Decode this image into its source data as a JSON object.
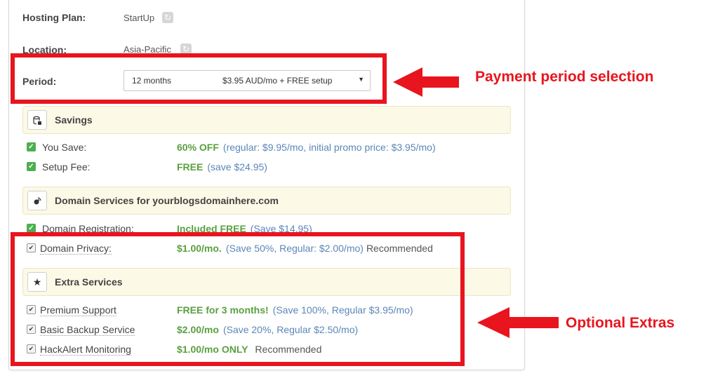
{
  "plan": {
    "label": "Hosting Plan:",
    "value": "StartUp"
  },
  "location": {
    "label": "Location:",
    "value": "Asia-Pacific"
  },
  "period": {
    "label": "Period:",
    "selected_term": "12 months",
    "selected_price": "$3.95 AUD/mo + FREE setup"
  },
  "savings": {
    "title": "Savings",
    "rows": [
      {
        "label": "You Save:",
        "value": "60% OFF",
        "detail": "(regular: $9.95/mo, initial promo price: $3.95/mo)"
      },
      {
        "label": "Setup Fee:",
        "value": "FREE",
        "detail": "(save $24.95)"
      }
    ]
  },
  "domain": {
    "title": "Domain Services for yourblogsdomainhere.com",
    "registration": {
      "label": "Domain Registration:",
      "value": "Included FREE",
      "detail": "(Save $14.95)"
    },
    "privacy": {
      "label": "Domain Privacy:",
      "value": "$1.00/mo.",
      "detail": "(Save 50%, Regular: $2.00/mo)",
      "note": "Recommended"
    }
  },
  "extras": {
    "title": "Extra Services",
    "items": [
      {
        "label": "Premium Support",
        "value": "FREE for 3 months!",
        "detail": "(Save 100%, Regular $3.95/mo)",
        "note": ""
      },
      {
        "label": "Basic Backup Service",
        "value": "$2.00/mo",
        "detail": "(Save 20%, Regular $2.50/mo)",
        "note": ""
      },
      {
        "label": "HackAlert Monitoring",
        "value": "$1.00/mo ONLY",
        "detail": "",
        "note": "Recommended"
      }
    ]
  },
  "annotations": {
    "period": "Payment period selection",
    "extras": "Optional Extras"
  },
  "colors": {
    "annotation_red": "#e8141e",
    "value_green": "#5aa03f",
    "detail_blue": "#5b86b8",
    "section_bg": "#fcf9e6"
  },
  "icons": {
    "refresh": "refresh-icon",
    "savings": "coins-icon",
    "domain": "domain-services-icon",
    "extras": "star-icon",
    "caret": "caret-down-icon"
  }
}
